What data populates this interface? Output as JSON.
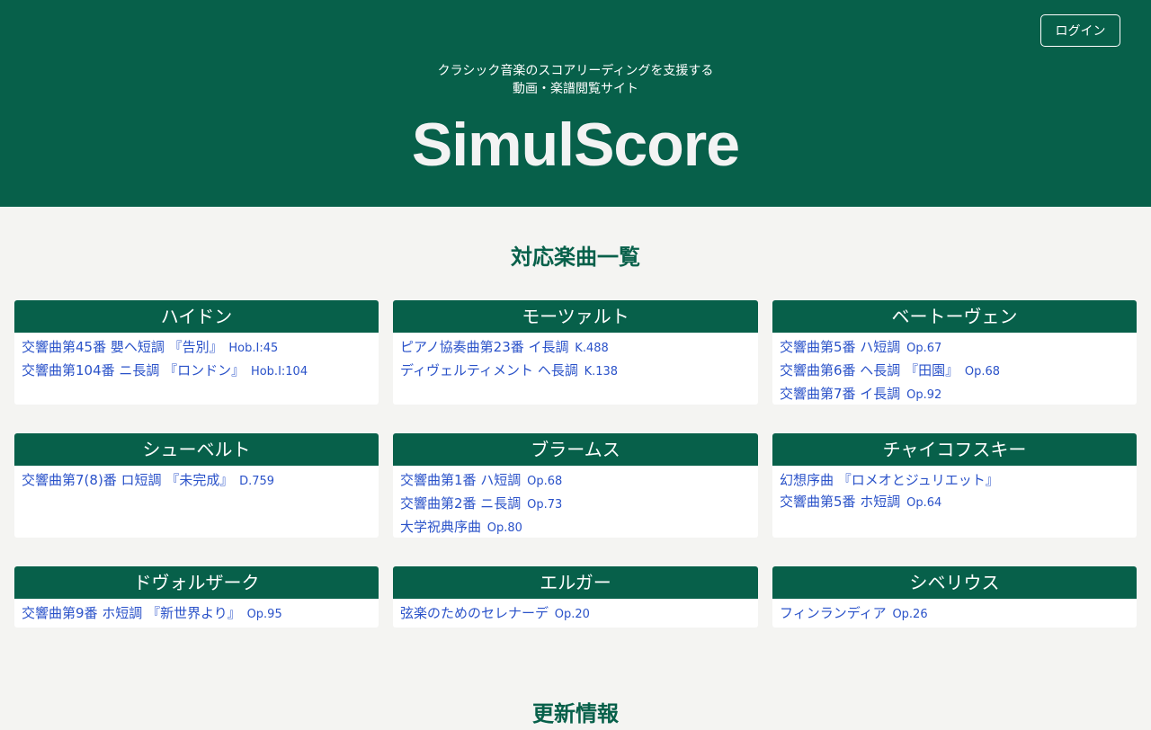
{
  "header": {
    "login_label": "ログイン",
    "tagline_line1": "クラシック音楽のスコアリーディングを支援する",
    "tagline_line2": "動画・楽譜閲覧サイト",
    "site_title": "SimulScore",
    "colors": {
      "primary": "#07604a",
      "link": "#2a52c9",
      "background": "#f4f4f2"
    }
  },
  "works_section": {
    "title": "対応楽曲一覧",
    "composers": [
      {
        "name": "ハイドン",
        "works": [
          {
            "title": "交響曲第45番 嬰ヘ短調 『告別』",
            "opus": "Hob.I:45"
          },
          {
            "title": "交響曲第104番 ニ長調 『ロンドン』",
            "opus": "Hob.I:104"
          }
        ]
      },
      {
        "name": "モーツァルト",
        "works": [
          {
            "title": "ピアノ協奏曲第23番 イ長調",
            "opus": "K.488"
          },
          {
            "title": "ディヴェルティメント ヘ長調",
            "opus": "K.138"
          }
        ]
      },
      {
        "name": "ベートーヴェン",
        "works": [
          {
            "title": "交響曲第5番 ハ短調",
            "opus": "Op.67"
          },
          {
            "title": "交響曲第6番 ヘ長調 『田園』",
            "opus": "Op.68"
          },
          {
            "title": "交響曲第7番 イ長調",
            "opus": "Op.92"
          }
        ]
      },
      {
        "name": "シューベルト",
        "works": [
          {
            "title": "交響曲第7(8)番 ロ短調 『未完成』",
            "opus": "D.759"
          }
        ]
      },
      {
        "name": "ブラームス",
        "works": [
          {
            "title": "交響曲第1番 ハ短調",
            "opus": "Op.68"
          },
          {
            "title": "交響曲第2番 ニ長調",
            "opus": "Op.73"
          },
          {
            "title": "大学祝典序曲",
            "opus": "Op.80"
          }
        ]
      },
      {
        "name": "チャイコフスキー",
        "works": [
          {
            "title": "幻想序曲 『ロメオとジュリエット』",
            "opus": ""
          },
          {
            "title": "交響曲第5番 ホ短調",
            "opus": "Op.64"
          }
        ]
      },
      {
        "name": "ドヴォルザーク",
        "works": [
          {
            "title": "交響曲第9番 ホ短調 『新世界より』",
            "opus": "Op.95"
          }
        ]
      },
      {
        "name": "エルガー",
        "works": [
          {
            "title": "弦楽のためのセレナーデ",
            "opus": "Op.20"
          }
        ]
      },
      {
        "name": "シベリウス",
        "works": [
          {
            "title": "フィンランディア",
            "opus": "Op.26"
          }
        ]
      }
    ]
  },
  "updates_section": {
    "title": "更新情報"
  }
}
